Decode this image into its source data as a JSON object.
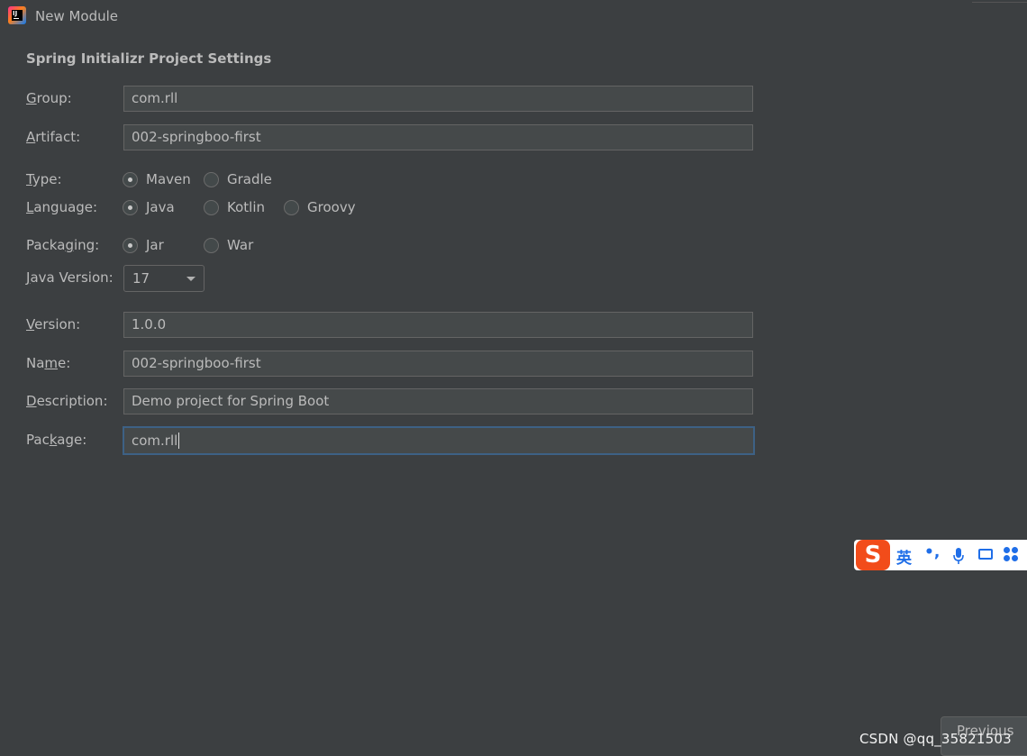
{
  "window": {
    "title": "New Module"
  },
  "section_title": "Spring Initializr Project Settings",
  "form": {
    "group": {
      "label_mn": "G",
      "label_rest": "roup:",
      "value": "com.rll"
    },
    "artifact": {
      "label_mn": "A",
      "label_rest": "rtifact:",
      "value": "002-springboo-first"
    },
    "type": {
      "label_mn": "T",
      "label_rest": "ype:",
      "options": [
        "Maven",
        "Gradle"
      ],
      "selected": "Maven"
    },
    "language": {
      "label_mn": "L",
      "label_rest": "anguage:",
      "options": [
        "Java",
        "Kotlin",
        "Groovy"
      ],
      "selected": "Java"
    },
    "packaging": {
      "label_pre": "Packa",
      "label_mn": "g",
      "label_rest": "ing:",
      "options": [
        "Jar",
        "War"
      ],
      "selected": "Jar"
    },
    "java_version": {
      "label_mn": "J",
      "label_rest": "ava Version:",
      "value": "17"
    },
    "version": {
      "label_mn": "V",
      "label_rest": "ersion:",
      "value": "1.0.0"
    },
    "name": {
      "label_pre": "Na",
      "label_mn": "m",
      "label_rest": "e:",
      "value": "002-springboo-first"
    },
    "description": {
      "label_mn": "D",
      "label_rest": "escription:",
      "value": "Demo project for Spring Boot"
    },
    "package": {
      "label_pre": "Pac",
      "label_mn": "k",
      "label_rest": "age:",
      "value": "com.rll"
    }
  },
  "ime_toolbar": {
    "logo": "S",
    "mode": "英",
    "punct": "•,",
    "mic_icon": "microphone-icon",
    "keyboard_icon": "keyboard-icon",
    "menu_icon": "grid-icon"
  },
  "footer": {
    "previous_label": "Previous",
    "watermark": "CSDN @qq_35821503"
  },
  "colors": {
    "background": "#3c3f41",
    "field": "#45494a",
    "focus_border": "#3d6185",
    "text": "#bbbbbb",
    "ime_accent": "#1f6ee8",
    "ime_logo": "#f24c1a"
  }
}
